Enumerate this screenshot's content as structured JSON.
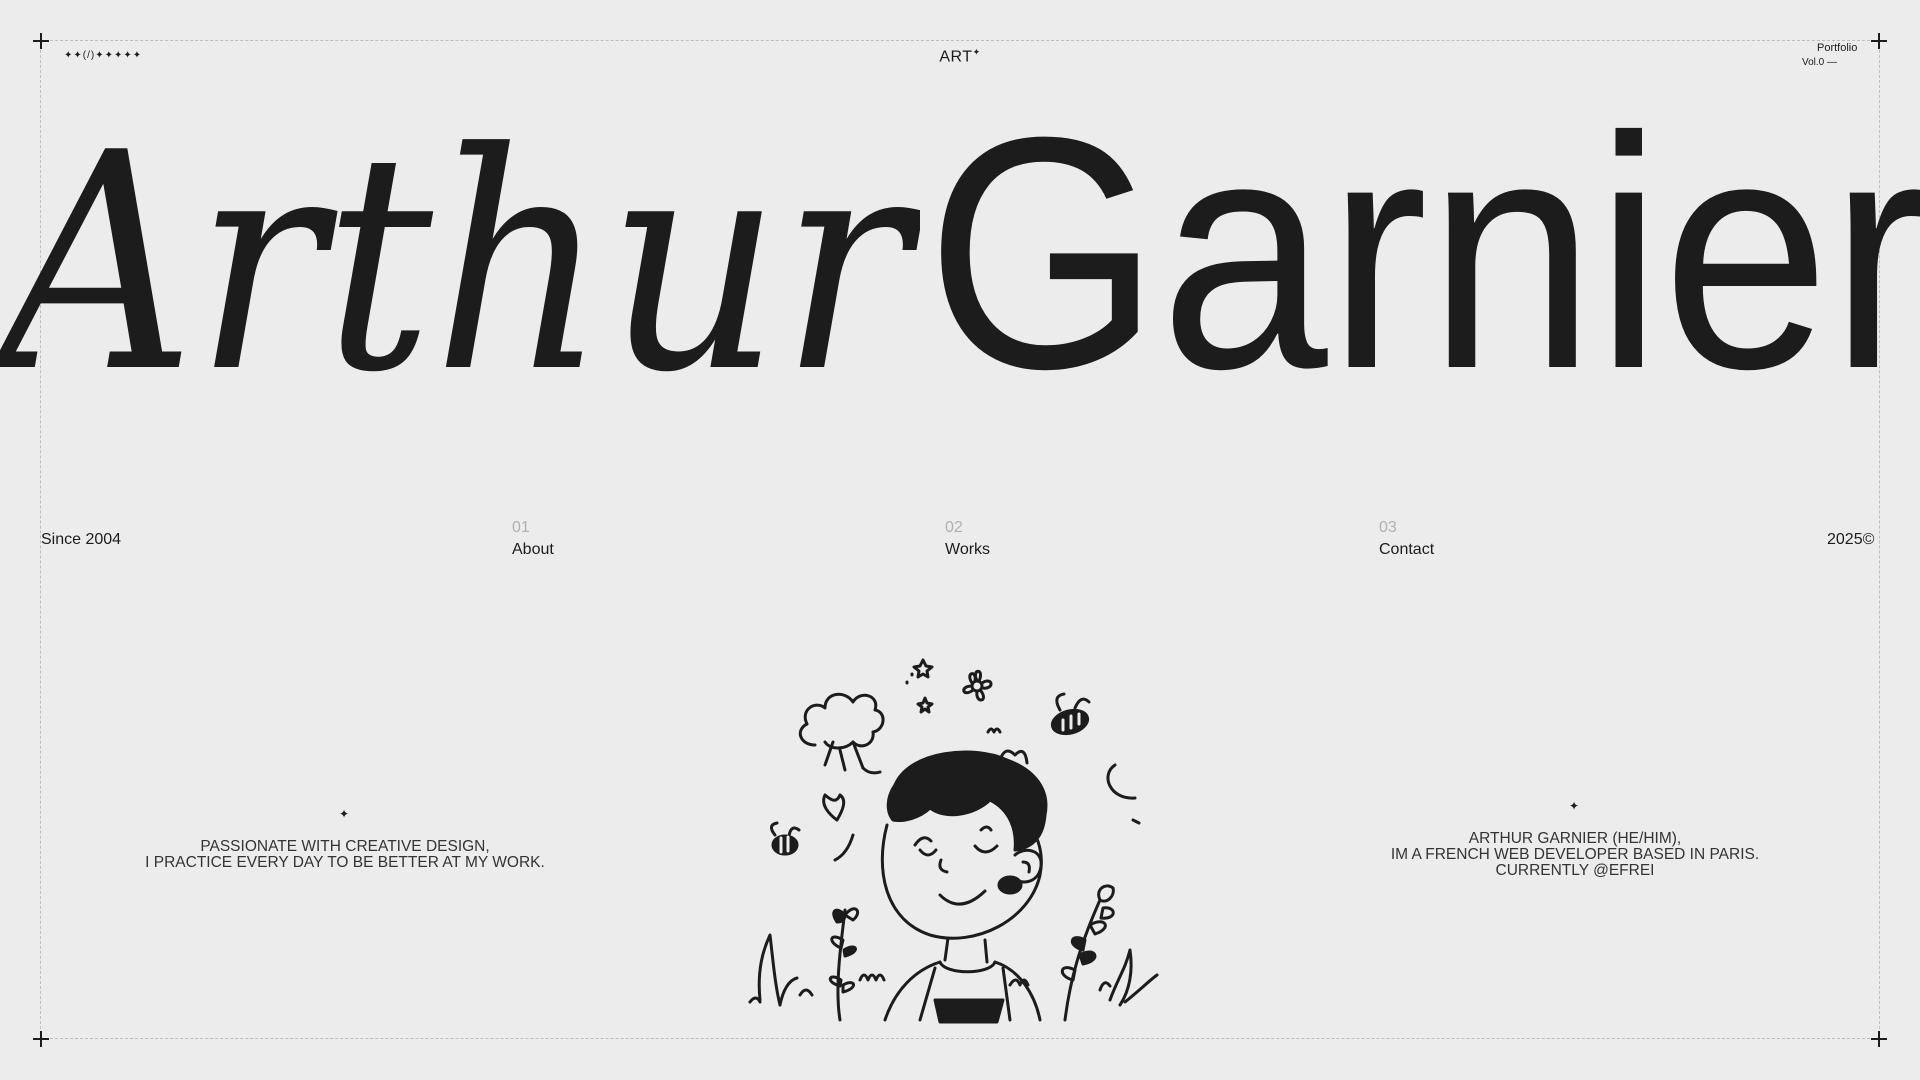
{
  "header": {
    "marks": "✦✦(/)✦✦✦✦✦",
    "logo": "ART",
    "logo_sup": "✦",
    "portfolio": "Portfolio",
    "volume": "Vol.0 —"
  },
  "hero": {
    "first_name": "Arthur",
    "last_name": "Garnier"
  },
  "nav": {
    "since": "Since 2004",
    "year": "2025©",
    "items": [
      {
        "num": "01",
        "label": "About"
      },
      {
        "num": "02",
        "label": "Works"
      },
      {
        "num": "03",
        "label": "Contact"
      }
    ]
  },
  "intro_left": {
    "star": "✦",
    "line1": "PASSIONATE WITH CREATIVE DESIGN,",
    "line2": "I PRACTICE EVERY DAY TO BE BETTER AT MY WORK."
  },
  "intro_right": {
    "star": "✦",
    "line1": "ARTHUR GARNIER (HE/HIM),",
    "line2": "IM A FRENCH WEB DEVELOPER BASED IN PARIS.",
    "line3": "CURRENTLY @EFREI"
  },
  "illustration": {
    "icon": "boy-with-flowers-illustration"
  },
  "colors": {
    "background": "#ececec",
    "ink": "#1c1c1c",
    "muted": "#b0b0b0"
  }
}
